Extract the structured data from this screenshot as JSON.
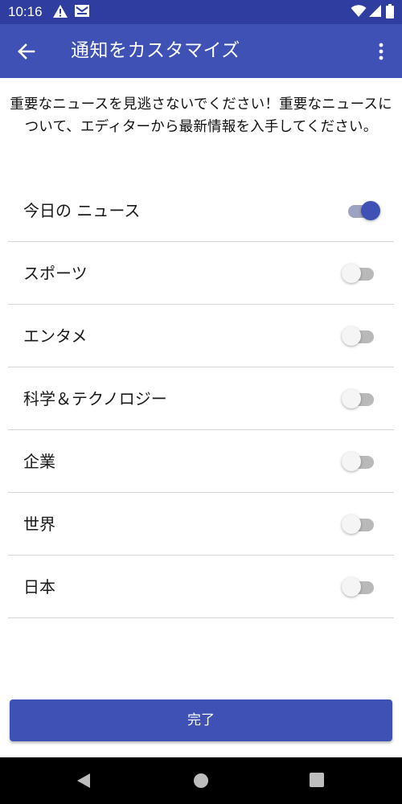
{
  "status_bar": {
    "time": "10:16",
    "icons": [
      "warning-icon",
      "mail-icon",
      "wifi-icon",
      "signal-icon",
      "battery-icon"
    ]
  },
  "toolbar": {
    "back_icon": "arrow-left-icon",
    "title": "通知をカスタマイズ",
    "more_icon": "more-vert-icon",
    "background": "#3f51b5"
  },
  "description": "重要なニュースを見逃さないでください！重要なニュースについて、エディターから最新情報を入手してください。",
  "categories": [
    {
      "label": "今日の ニュース",
      "enabled": true
    },
    {
      "label": "スポーツ",
      "enabled": false
    },
    {
      "label": "エンタメ",
      "enabled": false
    },
    {
      "label": "科学＆テクノロジー",
      "enabled": false
    },
    {
      "label": "企業",
      "enabled": false
    },
    {
      "label": "世界",
      "enabled": false
    },
    {
      "label": "日本",
      "enabled": false
    }
  ],
  "done_button": {
    "label": "完了"
  },
  "nav_bar": {
    "icons": [
      "back-triangle-icon",
      "home-circle-icon",
      "recents-square-icon"
    ]
  },
  "colors": {
    "accent": "#3f51b5",
    "status_bar": "#2f3da0"
  }
}
